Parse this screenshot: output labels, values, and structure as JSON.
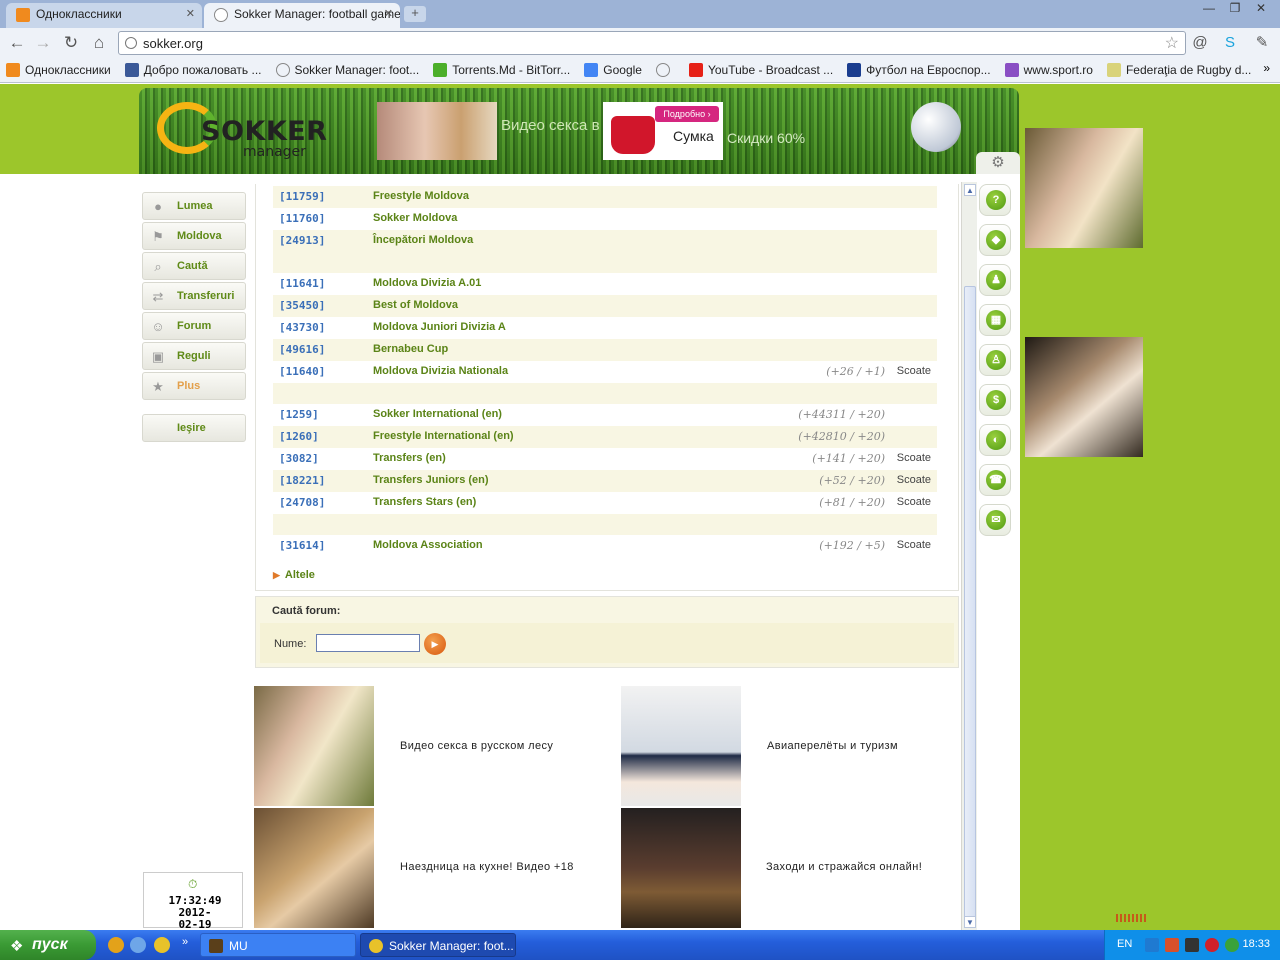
{
  "browser": {
    "tabs": [
      {
        "title": "Одноклассники",
        "active": false
      },
      {
        "title": "Sokker Manager: football game",
        "active": true
      }
    ],
    "url": "sokker.org",
    "bookmarks": [
      {
        "label": "Одноклассники",
        "icon": "odnoklassniki-icon",
        "color": "#f08a1e"
      },
      {
        "label": "Добро пожаловать ...",
        "icon": "facebook-icon",
        "color": "#3b5998"
      },
      {
        "label": "Sokker Manager: foot...",
        "icon": "globe-icon",
        "color": "#cccccc"
      },
      {
        "label": "Torrents.Md - BitTorr...",
        "icon": "torrents-md-icon",
        "color": "#4caf2a"
      },
      {
        "label": "Google",
        "icon": "google-icon",
        "color": "#4285f4"
      },
      {
        "label": "",
        "icon": "globe-icon",
        "color": "#cccccc"
      },
      {
        "label": "YouTube - Broadcast ...",
        "icon": "youtube-icon",
        "color": "#e62117"
      },
      {
        "label": "Футбол на Евроспор...",
        "icon": "eurosport-icon",
        "color": "#1a3d8f"
      },
      {
        "label": "www.sport.ro",
        "icon": "sport-ro-icon",
        "color": "#8a4fc4"
      },
      {
        "label": "Federaţia de Rugby d...",
        "icon": "rugby-icon",
        "color": "#d9d37a"
      }
    ]
  },
  "header": {
    "logo_text": "SOKKER",
    "logo_sub": "manager",
    "ad1_text": "Видео секса в",
    "ad2_button": "Подробно ›",
    "ad2_label": "Сумка",
    "ad2_text": "Скидки 60%"
  },
  "sidebar": {
    "items": [
      {
        "label": "Lumea",
        "icon": "globe-icon"
      },
      {
        "label": "Moldova",
        "icon": "flag-icon"
      },
      {
        "label": "Caută",
        "icon": "magnifier-icon"
      },
      {
        "label": "Transferuri",
        "icon": "transfer-icon"
      },
      {
        "label": "Forum",
        "icon": "users-icon"
      },
      {
        "label": "Reguli",
        "icon": "book-icon"
      },
      {
        "label": "Plus",
        "icon": "star-icon"
      }
    ],
    "logout": "Ieşire"
  },
  "forums": {
    "rows": [
      {
        "id": "[11759]",
        "name": "Freestyle Moldova",
        "stats": "",
        "action": ""
      },
      {
        "id": "[11760]",
        "name": "Sokker Moldova",
        "stats": "",
        "action": ""
      },
      {
        "id": "[24913]",
        "name": "Începători Moldova",
        "stats": "",
        "action": ""
      },
      {
        "id": "[11641]",
        "name": "Moldova Divizia A.01",
        "stats": "",
        "action": ""
      },
      {
        "id": "[35450]",
        "name": "Best of Moldova",
        "stats": "",
        "action": ""
      },
      {
        "id": "[43730]",
        "name": "Moldova Juniori Divizia A",
        "stats": "",
        "action": ""
      },
      {
        "id": "[49616]",
        "name": "Bernabeu Cup",
        "stats": "",
        "action": ""
      },
      {
        "id": "[11640]",
        "name": "Moldova Divizia Nationala",
        "stats": "(+26 / +1)",
        "action": "Scoate"
      },
      {
        "id": "[1259]",
        "name": "Sokker International (en)",
        "stats": "(+44311 / +20)",
        "action": ""
      },
      {
        "id": "[1260]",
        "name": "Freestyle International (en)",
        "stats": "(+42810 / +20)",
        "action": ""
      },
      {
        "id": "[3082]",
        "name": "Transfers (en)",
        "stats": "(+141 / +20)",
        "action": "Scoate"
      },
      {
        "id": "[18221]",
        "name": "Transfers Juniors (en)",
        "stats": "(+52 / +20)",
        "action": "Scoate"
      },
      {
        "id": "[24708]",
        "name": "Transfers Stars (en)",
        "stats": "(+81 / +20)",
        "action": "Scoate"
      },
      {
        "id": "[31614]",
        "name": "Moldova Association",
        "stats": "(+192 / +5)",
        "action": "Scoate"
      }
    ],
    "more": "Altele"
  },
  "search": {
    "title": "Caută forum:",
    "label": "Nume:",
    "value": ""
  },
  "ads": [
    {
      "text": "Видео секса в русском лесу"
    },
    {
      "text": "Авиаперелёты и туризм"
    },
    {
      "text": "Наездница на кухне! Видео +18"
    },
    {
      "text": "Заходи и стражайся онлайн!"
    }
  ],
  "clock": {
    "time": "17:32:49 2012-",
    "date": "02-19"
  },
  "taskbar": {
    "start": "пуск",
    "tasks": [
      {
        "label": "MU",
        "active": false
      },
      {
        "label": "Sokker Manager: foot...",
        "active": true
      }
    ],
    "lang": "EN",
    "time": "18:33"
  }
}
